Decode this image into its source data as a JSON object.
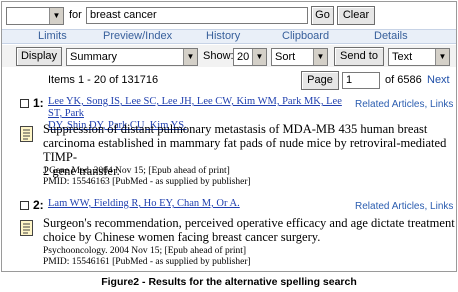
{
  "search": {
    "db_value": "",
    "for_label": "for",
    "query": "breast cancer",
    "go_label": "Go",
    "clear_label": "Clear"
  },
  "tabs": [
    "Limits",
    "Preview/Index",
    "History",
    "Clipboard",
    "Details"
  ],
  "toolbar": {
    "display_label": "Display",
    "display_format": "Summary",
    "show_label": "Show:",
    "show_value": "20",
    "sort_value": "Sort",
    "send_label": "Send to",
    "send_format": "Text"
  },
  "paging": {
    "items_text": "Items 1 - 20 of 131716",
    "page_label": "Page",
    "page_value": "1",
    "of_text": "of 6586",
    "next_label": "Next"
  },
  "results": [
    {
      "number": "1:",
      "authors_line1": "Lee YK, Song IS, Lee SC, Lee JH, Lee CW, Kim WM, Park MK, Lee ST, Park",
      "authors_line2": "DY, Shin DY, Park CU, Kim YS.",
      "related": "Related Articles, Links",
      "title_lines": [
        "Suppression of distant pulmonary metastasis of MDA-MB 435 human breast",
        "carcinoma established in mammary fat pads of nude mice by retroviral-mediated TIMP-",
        "2 gene transfer."
      ],
      "source": "J Gene Med. 2004 Nov 15; [Epub ahead of print]",
      "pmid": "PMID: 15546163 [PubMed - as supplied by publisher]"
    },
    {
      "number": "2:",
      "authors_line1": "Lam WW, Fielding R, Ho EY, Chan M, Or A.",
      "authors_line2": "",
      "related": "Related Articles, Links",
      "title_lines": [
        "Surgeon's recommendation, perceived operative efficacy and age dictate treatment",
        "choice by Chinese women facing breast cancer surgery."
      ],
      "source": "Psychooncology. 2004 Nov 15; [Epub ahead of print]",
      "pmid": "PMID: 15546161 [PubMed - as supplied by publisher]"
    }
  ],
  "caption": "Figure2 - Results for the alternative spelling search"
}
